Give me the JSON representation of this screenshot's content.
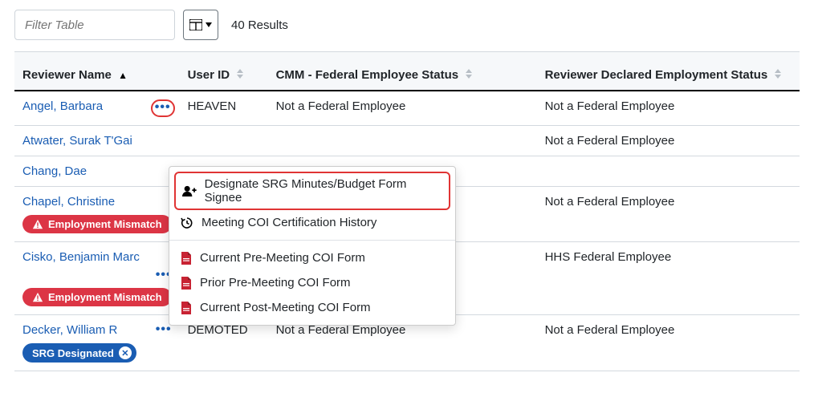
{
  "toolbar": {
    "filter_placeholder": "Filter Table",
    "results_text": "40 Results"
  },
  "columns": {
    "name": "Reviewer Name",
    "user_id": "User ID",
    "cmm": "CMM - Federal Employee Status",
    "declared": "Reviewer Declared Employment Status"
  },
  "badges": {
    "employment_mismatch": "Employment Mismatch",
    "srg_designated": "SRG Designated"
  },
  "menu": {
    "designate": "Designate SRG Minutes/Budget Form Signee",
    "history": "Meeting COI Certification History",
    "current_pre": "Current Pre-Meeting COI Form",
    "prior_pre": "Prior Pre-Meeting COI Form",
    "current_post": "Current Post-Meeting COI Form"
  },
  "rows": [
    {
      "name": "Angel, Barbara",
      "user_id": "HEAVEN",
      "cmm": "Not a Federal Employee",
      "declared": "Not a Federal Employee"
    },
    {
      "name": "Atwater, Surak T'Gai",
      "user_id": "",
      "cmm": "",
      "declared": "Not a Federal Employee"
    },
    {
      "name": "Chang, Dae",
      "user_id": "",
      "cmm": "",
      "declared": ""
    },
    {
      "name": "Chapel, Christine",
      "user_id": "",
      "cmm": "",
      "declared": "Not a Federal Employee"
    },
    {
      "name": "Cisko, Benjamin Marc",
      "user_id": "",
      "cmm": "",
      "declared": "HHS Federal Employee"
    },
    {
      "name": "Decker, William R",
      "user_id": "DEMOTED",
      "cmm": "Not a Federal Employee",
      "declared": "Not a Federal Employee"
    }
  ]
}
